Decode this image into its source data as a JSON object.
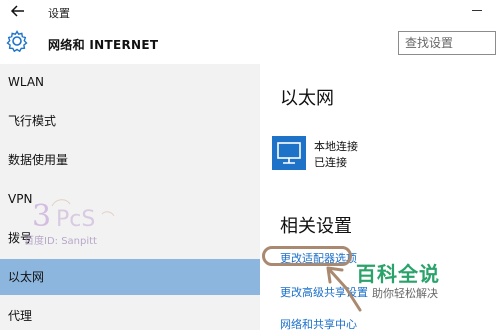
{
  "window": {
    "title": "设置",
    "back_icon": "back-arrow-icon",
    "minimize_icon": "minimize-icon"
  },
  "header": {
    "title": "网络和 INTERNET",
    "icon": "gear-icon"
  },
  "search": {
    "placeholder": "查找设置"
  },
  "sidebar": {
    "items": [
      {
        "label": "WLAN",
        "active": false
      },
      {
        "label": "飞行模式",
        "active": false
      },
      {
        "label": "数据使用量",
        "active": false
      },
      {
        "label": "VPN",
        "active": false
      },
      {
        "label": "拨号",
        "active": false
      },
      {
        "label": "以太网",
        "active": true
      },
      {
        "label": "代理",
        "active": false
      }
    ],
    "active_color": "#8db6de"
  },
  "watermark": {
    "text": "百度ID: Sanpitt",
    "logo": "3pcs-logo"
  },
  "main": {
    "title": "以太网",
    "connection": {
      "name": "本地连接",
      "status": "已连接",
      "icon": "monitor-network-icon",
      "icon_color": "#1e73c9"
    },
    "related_title": "相关设置",
    "links": [
      "更改适配器选项",
      "更改高级共享设置",
      "网络和共享中心"
    ],
    "link_color": "#1a6fc9"
  },
  "brand": {
    "title": "百科全说",
    "subtitle": "助你轻松解决",
    "color": "#2aa26a"
  }
}
